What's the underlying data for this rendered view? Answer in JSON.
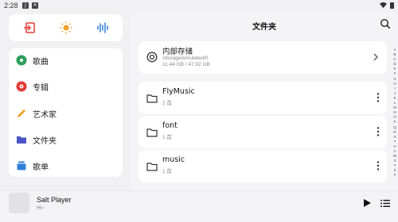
{
  "status": {
    "time": "2:28"
  },
  "sidebar": {
    "quick_icons": [
      "exit-icon",
      "sun-icon",
      "waveform-icon"
    ],
    "items": [
      {
        "label": "歌曲",
        "icon": "disc-icon",
        "color": "#2e9e5b"
      },
      {
        "label": "专辑",
        "icon": "album-icon",
        "color": "#e23b36"
      },
      {
        "label": "艺术家",
        "icon": "pencil-icon",
        "color": "#f2a12a"
      },
      {
        "label": "文件夹",
        "icon": "folder-icon",
        "color": "#4b55c8"
      },
      {
        "label": "歌单",
        "icon": "stack-icon",
        "color": "#2e7fd8"
      }
    ]
  },
  "main": {
    "title": "文件夹",
    "storage": {
      "name": "内部存储",
      "path": "/storage/emulated/0",
      "size": "11.44 GB / 47.92 GB"
    },
    "folders": [
      {
        "name": "FlyMusic",
        "count": "2 首"
      },
      {
        "name": "font",
        "count": "1 首"
      },
      {
        "name": "music",
        "count": "1 首"
      }
    ],
    "alphabet": [
      "A",
      "B",
      "C",
      "D",
      "E",
      "F",
      "G",
      "H",
      "I",
      "J",
      "K",
      "L",
      "M",
      "N",
      "O",
      "P",
      "Q",
      "R",
      "S",
      "T",
      "U",
      "V",
      "W",
      "X",
      "Y",
      "Z",
      "#"
    ]
  },
  "player": {
    "song": "Salt Player",
    "artist": "Hi~"
  },
  "colors": {
    "accent_red": "#e23b36",
    "accent_orange": "#f2a12a",
    "accent_blue": "#2e7fd8"
  }
}
